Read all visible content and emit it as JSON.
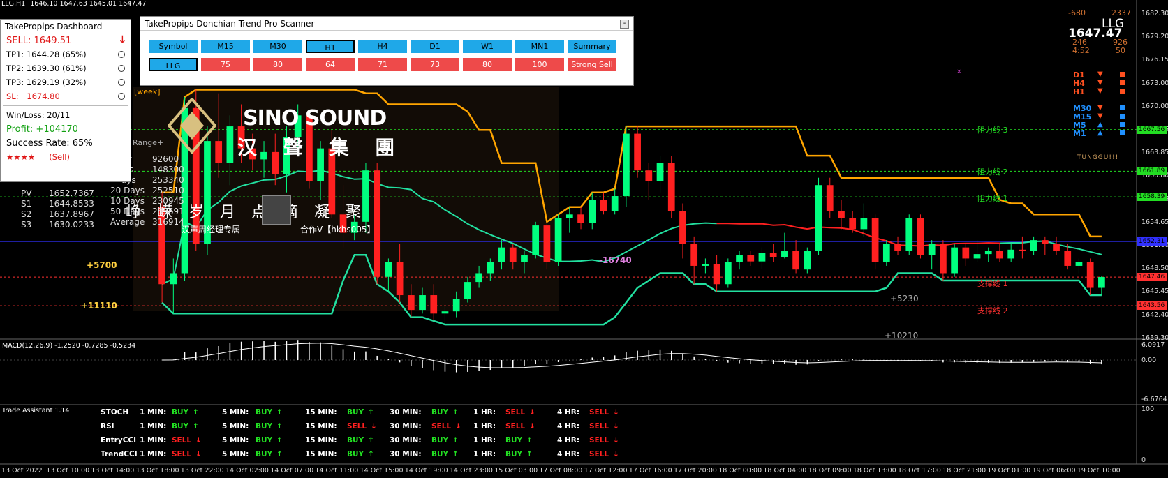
{
  "window": {
    "title": "LLG,H1",
    "ohlc": "1646.10 1647.63 1645.01 1647.47"
  },
  "colors": {
    "bull": "#00ff7f",
    "bear": "#ff2020",
    "donchian_upper": "#ffa500",
    "ma_green": "#22e0a0",
    "ma_red": "#ff2020",
    "resistance": "#22dd22",
    "support": "#ff3030",
    "blue_line": "#3030ff"
  },
  "dashboard": {
    "title": "TakePropips Dashboard",
    "signal_label": "SELL:",
    "signal_price": "1649.51",
    "arrow_icon": "down-arrow-icon",
    "tps": [
      {
        "label": "TP1: 1644.28 (65%)"
      },
      {
        "label": "TP2: 1639.30 (61%)"
      },
      {
        "label": "TP3: 1629.19 (32%)"
      }
    ],
    "sl_label": "SL:",
    "sl_value": "1674.80",
    "winloss": "Win/Loss: 20/11",
    "profit": "Profit: +104170",
    "success": "Success Rate: 65%",
    "stars": "★★★★",
    "stars_note": "(Sell)"
  },
  "scanner": {
    "title": "TakePropips Donchian Trend Pro Scanner",
    "minimize": "-",
    "headers": [
      "Symbol",
      "M15",
      "M30",
      "H1",
      "H4",
      "D1",
      "W1",
      "MN1",
      "Summary"
    ],
    "values": [
      "LLG",
      "75",
      "80",
      "64",
      "71",
      "73",
      "80",
      "100",
      "Strong Sell"
    ]
  },
  "overlay_left": {
    "week_label": "[week]",
    "range_label": "y Range+",
    "ranges": [
      {
        "label": "y",
        "value": "92600"
      },
      {
        "label": "ys",
        "value": "148300"
      },
      {
        "label": "ays",
        "value": "253340"
      },
      {
        "label": "20 Days",
        "value": "252510"
      },
      {
        "label": "10 Days",
        "value": "230945"
      },
      {
        "label": "50 Days",
        "value": "283691"
      },
      {
        "label": "Average",
        "value": "316914"
      }
    ],
    "pivots": [
      {
        "label": "PV",
        "value": "1652.7367"
      },
      {
        "label": "S1",
        "value": "1644.8533"
      },
      {
        "label": "S2",
        "value": "1637.8967"
      },
      {
        "label": "S3",
        "value": "1630.0233"
      }
    ]
  },
  "watermark": {
    "brand": "SINO SOUND",
    "brand_cn": "汉 聲 集 團",
    "motto": "峥 嵘 岁 月    点 滴 凝 聚",
    "manager": "汉声周经理专属",
    "contact": "合作V【hkhs005】"
  },
  "top_right": {
    "a": "-680",
    "b": "2337",
    "symbol": "LLG",
    "price": "1647.47",
    "c": "246",
    "d": "926",
    "time": "4:52",
    "e": "50"
  },
  "tf_panel": [
    {
      "tf": "D1",
      "dir": "down"
    },
    {
      "tf": "H4",
      "dir": "down"
    },
    {
      "tf": "H1",
      "dir": "down"
    },
    {
      "tf": "M30",
      "dir": "down"
    },
    {
      "tf": "M15",
      "dir": "down"
    },
    {
      "tf": "M5",
      "dir": "up"
    },
    {
      "tf": "M1",
      "dir": "up"
    }
  ],
  "tunggu": "TUNGGU!!!",
  "chart_labels": {
    "plus5700": "+5700",
    "plus11110": "+11110",
    "minus16740": "-16740",
    "plus5230": "+5230",
    "plus10210": "+10210",
    "res1": "阻力线 1",
    "res2": "阻力线 2",
    "res3": "阻力线 3",
    "sup1": "支撑线 1",
    "sup2": "支撑线 2"
  },
  "price_axis": [
    "1682.30",
    "1679.20",
    "1676.15",
    "1673.00",
    "1670.00",
    "1666.95",
    "1663.85",
    "1660.80",
    "1657.75",
    "1654.65",
    "1651.60",
    "1648.50",
    "1645.45",
    "1642.40",
    "1639.30"
  ],
  "price_tags": [
    {
      "value": "1667.56",
      "color": "#22dd22"
    },
    {
      "value": "1661.89",
      "color": "#22dd22"
    },
    {
      "value": "1658.39",
      "color": "#22dd22"
    },
    {
      "value": "1652.31",
      "color": "#3030ff"
    },
    {
      "value": "1647.46",
      "color": "#ff3030"
    },
    {
      "value": "1643.56",
      "color": "#ff3030"
    }
  ],
  "macd": {
    "label": "MACD(12,26,9) -1.2520 -0.7285 -0.5234",
    "axis": [
      "6.0917",
      "0.00",
      "-6.6764"
    ]
  },
  "trade_assistant": {
    "title": "Trade Assistant 1.14",
    "axis": [
      "100",
      "0"
    ],
    "rows": [
      {
        "name": "STOCH",
        "cells": [
          [
            "1 MIN:",
            "BUY"
          ],
          [
            "5 MIN:",
            "BUY"
          ],
          [
            "15 MIN:",
            "BUY"
          ],
          [
            "30 MIN:",
            "BUY"
          ],
          [
            "1 HR:",
            "SELL"
          ],
          [
            "4 HR:",
            "SELL"
          ]
        ]
      },
      {
        "name": "RSI",
        "cells": [
          [
            "1 MIN:",
            "BUY"
          ],
          [
            "5 MIN:",
            "BUY"
          ],
          [
            "15 MIN:",
            "SELL"
          ],
          [
            "30 MIN:",
            "SELL"
          ],
          [
            "1 HR:",
            "SELL"
          ],
          [
            "4 HR:",
            "SELL"
          ]
        ]
      },
      {
        "name": "EntryCCI",
        "cells": [
          [
            "1 MIN:",
            "SELL"
          ],
          [
            "5 MIN:",
            "BUY"
          ],
          [
            "15 MIN:",
            "BUY"
          ],
          [
            "30 MIN:",
            "BUY"
          ],
          [
            "1 HR:",
            "BUY"
          ],
          [
            "4 HR:",
            "SELL"
          ]
        ]
      },
      {
        "name": "TrendCCI",
        "cells": [
          [
            "1 MIN:",
            "SELL"
          ],
          [
            "5 MIN:",
            "BUY"
          ],
          [
            "15 MIN:",
            "BUY"
          ],
          [
            "30 MIN:",
            "BUY"
          ],
          [
            "1 HR:",
            "BUY"
          ],
          [
            "4 HR:",
            "SELL"
          ]
        ]
      }
    ]
  },
  "time_axis": [
    "13 Oct 2022",
    "13 Oct 10:00",
    "13 Oct 14:00",
    "13 Oct 18:00",
    "13 Oct 22:00",
    "14 Oct 02:00",
    "14 Oct 07:00",
    "14 Oct 11:00",
    "14 Oct 15:00",
    "14 Oct 19:00",
    "14 Oct 23:00",
    "15 Oct 03:00",
    "17 Oct 08:00",
    "17 Oct 12:00",
    "17 Oct 16:00",
    "17 Oct 20:00",
    "18 Oct 00:00",
    "18 Oct 04:00",
    "18 Oct 09:00",
    "18 Oct 13:00",
    "18 Oct 17:00",
    "18 Oct 21:00",
    "19 Oct 01:00",
    "19 Oct 06:00",
    "19 Oct 10:00"
  ],
  "chart_data": {
    "type": "candlestick",
    "symbol": "LLG",
    "timeframe": "H1",
    "ylim": [
      1639.3,
      1683.5
    ],
    "candles": [
      [
        1657.0,
        1659.0,
        1644.0,
        1646.5
      ],
      [
        1646.5,
        1650.0,
        1642.5,
        1648.0
      ],
      [
        1648.0,
        1672.0,
        1647.0,
        1670.5
      ],
      [
        1670.5,
        1673.0,
        1651.0,
        1652.0
      ],
      [
        1652.0,
        1668.0,
        1650.5,
        1666.0
      ],
      [
        1666.0,
        1672.5,
        1661.0,
        1663.0
      ],
      [
        1663.0,
        1669.5,
        1660.0,
        1668.0
      ],
      [
        1668.0,
        1671.0,
        1663.0,
        1665.0
      ],
      [
        1665.0,
        1667.0,
        1662.0,
        1663.5
      ],
      [
        1663.5,
        1666.0,
        1661.0,
        1664.5
      ],
      [
        1664.5,
        1667.0,
        1660.0,
        1661.5
      ],
      [
        1661.5,
        1668.0,
        1659.0,
        1666.5
      ],
      [
        1666.5,
        1671.0,
        1664.0,
        1669.5
      ],
      [
        1669.5,
        1670.0,
        1659.5,
        1660.5
      ],
      [
        1660.5,
        1666.0,
        1658.0,
        1665.0
      ],
      [
        1665.0,
        1667.5,
        1655.5,
        1656.0
      ],
      [
        1656.0,
        1660.0,
        1651.5,
        1653.5
      ],
      [
        1653.5,
        1656.0,
        1652.5,
        1655.0
      ],
      [
        1655.0,
        1663.0,
        1653.5,
        1662.0
      ],
      [
        1662.0,
        1663.0,
        1646.5,
        1647.5
      ],
      [
        1647.5,
        1650.0,
        1645.5,
        1649.5
      ],
      [
        1649.5,
        1652.0,
        1644.0,
        1645.0
      ],
      [
        1645.0,
        1646.5,
        1642.0,
        1643.0
      ],
      [
        1643.0,
        1646.0,
        1642.5,
        1645.0
      ],
      [
        1645.0,
        1646.5,
        1641.5,
        1642.5
      ],
      [
        1642.5,
        1643.5,
        1641.0,
        1642.8
      ],
      [
        1642.8,
        1645.5,
        1642.0,
        1644.5
      ],
      [
        1644.5,
        1647.5,
        1644.0,
        1646.8
      ],
      [
        1646.8,
        1649.0,
        1646.0,
        1648.0
      ],
      [
        1648.0,
        1650.0,
        1647.0,
        1649.5
      ],
      [
        1649.5,
        1652.5,
        1648.5,
        1651.5
      ],
      [
        1651.5,
        1652.0,
        1648.5,
        1649.5
      ],
      [
        1649.5,
        1651.0,
        1648.0,
        1650.5
      ],
      [
        1650.5,
        1655.0,
        1650.0,
        1654.5
      ],
      [
        1654.5,
        1655.0,
        1648.5,
        1649.5
      ],
      [
        1649.5,
        1656.0,
        1649.0,
        1655.5
      ],
      [
        1655.5,
        1657.0,
        1653.5,
        1656.0
      ],
      [
        1656.0,
        1657.0,
        1654.0,
        1654.8
      ],
      [
        1654.8,
        1659.0,
        1654.0,
        1658.0
      ],
      [
        1658.0,
        1659.0,
        1656.0,
        1656.5
      ],
      [
        1656.5,
        1659.5,
        1656.0,
        1658.5
      ],
      [
        1658.5,
        1668.0,
        1657.0,
        1667.0
      ],
      [
        1667.0,
        1668.0,
        1661.0,
        1662.0
      ],
      [
        1662.0,
        1663.0,
        1658.0,
        1660.5
      ],
      [
        1660.5,
        1664.0,
        1659.0,
        1663.0
      ],
      [
        1663.0,
        1664.0,
        1655.5,
        1656.5
      ],
      [
        1656.5,
        1657.5,
        1650.0,
        1652.0
      ],
      [
        1652.0,
        1653.0,
        1646.5,
        1649.0
      ],
      [
        1649.0,
        1650.0,
        1648.0,
        1649.2
      ],
      [
        1649.2,
        1650.5,
        1645.5,
        1646.5
      ],
      [
        1646.5,
        1650.0,
        1646.0,
        1649.5
      ],
      [
        1649.5,
        1651.0,
        1648.5,
        1650.5
      ],
      [
        1650.5,
        1651.0,
        1649.0,
        1649.6
      ],
      [
        1649.6,
        1651.5,
        1648.5,
        1650.8
      ],
      [
        1650.8,
        1652.0,
        1649.5,
        1650.2
      ],
      [
        1650.2,
        1653.5,
        1650.0,
        1651.0
      ],
      [
        1651.0,
        1652.5,
        1648.0,
        1648.5
      ],
      [
        1648.5,
        1651.5,
        1648.0,
        1651.0
      ],
      [
        1651.0,
        1661.0,
        1650.5,
        1660.0
      ],
      [
        1660.0,
        1661.0,
        1655.5,
        1656.5
      ],
      [
        1656.5,
        1658.0,
        1654.0,
        1655.5
      ],
      [
        1655.5,
        1656.5,
        1653.5,
        1654.0
      ],
      [
        1654.0,
        1657.5,
        1653.0,
        1655.5
      ],
      [
        1655.5,
        1656.0,
        1648.5,
        1649.5
      ],
      [
        1649.5,
        1652.5,
        1649.0,
        1652.0
      ],
      [
        1652.0,
        1653.0,
        1650.5,
        1651.0
      ],
      [
        1651.0,
        1656.0,
        1650.5,
        1655.5
      ],
      [
        1655.5,
        1656.0,
        1650.0,
        1650.5
      ],
      [
        1650.5,
        1652.5,
        1648.5,
        1652.0
      ],
      [
        1652.0,
        1652.5,
        1647.0,
        1648.0
      ],
      [
        1648.0,
        1652.0,
        1647.5,
        1651.5
      ],
      [
        1651.5,
        1652.0,
        1649.0,
        1650.0
      ],
      [
        1650.0,
        1652.5,
        1649.5,
        1650.6
      ],
      [
        1650.6,
        1651.5,
        1649.5,
        1651.0
      ],
      [
        1651.0,
        1652.0,
        1649.5,
        1650.0
      ],
      [
        1650.0,
        1652.0,
        1649.5,
        1651.2
      ],
      [
        1651.2,
        1653.0,
        1650.0,
        1651.0
      ],
      [
        1651.0,
        1653.0,
        1650.5,
        1652.5
      ],
      [
        1652.5,
        1653.0,
        1650.5,
        1652.0
      ],
      [
        1652.0,
        1653.0,
        1650.5,
        1651.0
      ],
      [
        1651.0,
        1652.0,
        1648.5,
        1649.0
      ],
      [
        1649.0,
        1650.0,
        1648.0,
        1649.5
      ],
      [
        1649.5,
        1650.0,
        1645.0,
        1646.0
      ],
      [
        1646.0,
        1647.6,
        1645.0,
        1647.47
      ]
    ],
    "donchian_upper": [
      1677.0,
      1677.0,
      1677.0,
      1677.0,
      1676.5,
      1676.5,
      1676.0,
      1675.0,
      1675.0,
      1675.0,
      1674.5,
      1674.5,
      1674.5,
      1674.5,
      1674.5,
      1674.5,
      1674.5,
      1674.5,
      1674.5,
      1674.5,
      1674.5,
      1674.5,
      1674.5,
      1674.5,
      1674.5,
      1674.5,
      1674.5,
      1674.5,
      1674.5,
      1674.5,
      1674.5,
      1674.5,
      1674.5,
      1674.5,
      1674.5,
      1674.5,
      1674.5,
      1674.5,
      1674.5,
      1674.5,
      1674.5,
      1674.5,
      1674.5,
      1674.5,
      1674.5,
      1674.5,
      1674.5,
      1674.5,
      1674.5,
      1674.5
    ],
    "levels": {
      "resistance": [
        1667.56,
        1661.89,
        1658.39
      ],
      "support": [
        1647.46,
        1643.56
      ],
      "blue": 1652.31
    }
  }
}
